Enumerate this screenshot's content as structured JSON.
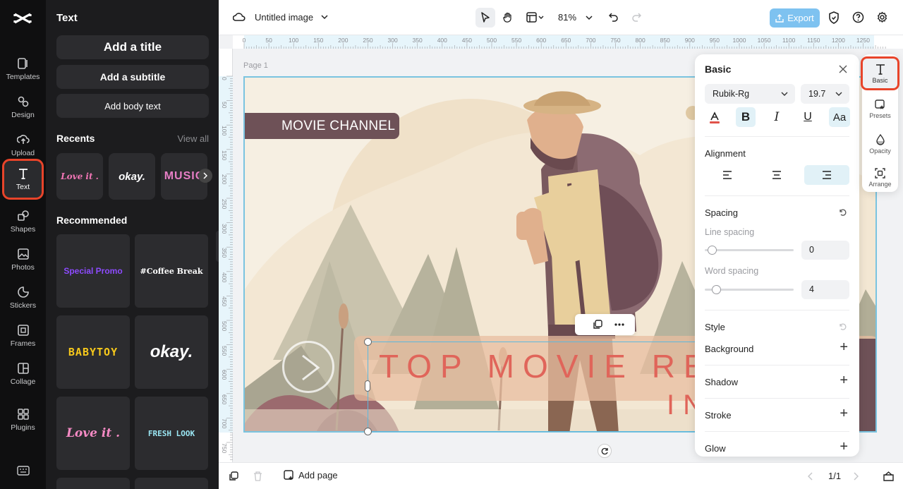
{
  "rail": {
    "items": [
      {
        "label": "Templates",
        "icon": "templates-icon"
      },
      {
        "label": "Design",
        "icon": "design-icon"
      },
      {
        "label": "Upload",
        "icon": "upload-icon"
      },
      {
        "label": "Text",
        "icon": "text-icon"
      },
      {
        "label": "Shapes",
        "icon": "shapes-icon"
      },
      {
        "label": "Photos",
        "icon": "photos-icon"
      },
      {
        "label": "Stickers",
        "icon": "stickers-icon"
      },
      {
        "label": "Frames",
        "icon": "frames-icon"
      },
      {
        "label": "Collage",
        "icon": "collage-icon"
      },
      {
        "label": "Plugins",
        "icon": "plugins-icon"
      }
    ]
  },
  "panel": {
    "title": "Text",
    "add_title": "Add a title",
    "add_subtitle": "Add a subtitle",
    "add_body": "Add body text",
    "recents_heading": "Recents",
    "view_all": "View all",
    "recents": [
      "Love it .",
      "okay.",
      "MUSIC"
    ],
    "recommended_heading": "Recommended",
    "recommended": [
      "Special Promo",
      "#Coffee Break",
      "BABYTOY",
      "okay.",
      "Love it .",
      "FRESH LOOK"
    ]
  },
  "topbar": {
    "doc_title": "Untitled image",
    "zoom": "81%",
    "export_label": "Export"
  },
  "ruler": {
    "h_ticks": [
      "0",
      "50",
      "100",
      "150",
      "200",
      "250",
      "300",
      "350",
      "400",
      "450",
      "500",
      "550",
      "600",
      "650",
      "700",
      "750",
      "800",
      "850",
      "900",
      "950",
      "1000",
      "1050",
      "1100",
      "1150",
      "1200",
      "1250"
    ],
    "v_ticks": [
      "0",
      "50",
      "100",
      "150",
      "200",
      "250",
      "300",
      "350",
      "400",
      "450",
      "500",
      "550",
      "600",
      "650",
      "700",
      "750"
    ]
  },
  "canvas": {
    "page_label": "Page 1",
    "movie_channel": "MOVIE CHANNEL",
    "headline": "TOP MOVIE RE",
    "headline2": "IN"
  },
  "props": {
    "title": "Basic",
    "font": "Rubik-Rg",
    "size": "19.7",
    "alignment_label": "Alignment",
    "spacing_label": "Spacing",
    "line_spacing_label": "Line spacing",
    "line_spacing_value": "0",
    "line_spacing_level": 0.08,
    "word_spacing_label": "Word spacing",
    "word_spacing_value": "4",
    "word_spacing_level": 0.13,
    "style_label": "Style",
    "background_label": "Background",
    "shadow_label": "Shadow",
    "stroke_label": "Stroke",
    "glow_label": "Glow"
  },
  "right_tabs": [
    {
      "label": "Basic",
      "icon": "text-icon"
    },
    {
      "label": "Presets",
      "icon": "presets-icon"
    },
    {
      "label": "Opacity",
      "icon": "opacity-icon"
    },
    {
      "label": "Arrange",
      "icon": "arrange-icon"
    }
  ],
  "bottombar": {
    "add_page": "Add page",
    "page_counter": "1/1"
  },
  "colors": {
    "accent": "#e8442a",
    "export_bg": "#7ec2f0",
    "canvas_bg": "#f6efe2",
    "headline": "#e0655a",
    "banner": "#6e5157"
  }
}
